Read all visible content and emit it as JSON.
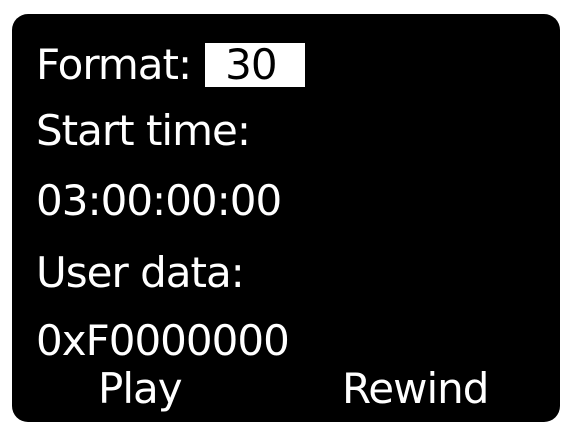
{
  "format": {
    "label": "Format:",
    "value": "30"
  },
  "start_time": {
    "label": "Start time:",
    "value": "03:00:00:00"
  },
  "user_data": {
    "label": "User data:",
    "value": "0xF0000000"
  },
  "softkeys": {
    "left": "Play",
    "right": "Rewind"
  },
  "colors": {
    "background": "#000000",
    "text": "#ffffff",
    "highlight": "#ffffff"
  }
}
